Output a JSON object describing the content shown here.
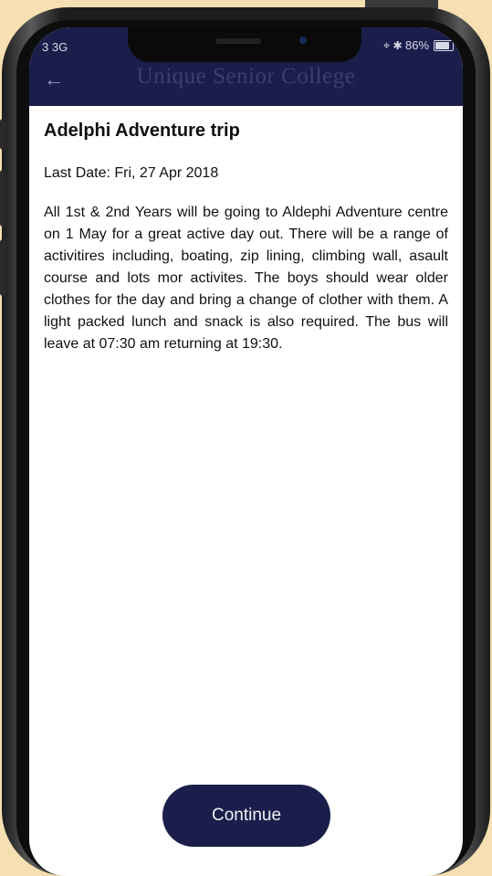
{
  "status_bar": {
    "carrier": "3 3G",
    "right": "⌖ ✱ 86%"
  },
  "header": {
    "back_icon": "arrow-left-icon",
    "title": "Unique Senior College"
  },
  "notice": {
    "title": "Adelphi Adventure trip",
    "last_date": "Last Date: Fri, 27 Apr 2018",
    "description": "All 1st & 2nd Years will be going to Aldephi Adventure centre on 1 May for a great active day out. There will be a range of activitires including, boating, zip lining, climbing wall, asault course and lots mor activites. The boys should wear older clothes for the day and bring a change of clother with them. A light packed lunch and snack is also required. The bus will leave at 07:30 am returning at 19:30."
  },
  "footer": {
    "continue_label": "Continue"
  },
  "colors": {
    "header_bg": "#1b1e4b",
    "button_bg": "#1b1e4b",
    "page_bg": "#f6dfb0"
  }
}
